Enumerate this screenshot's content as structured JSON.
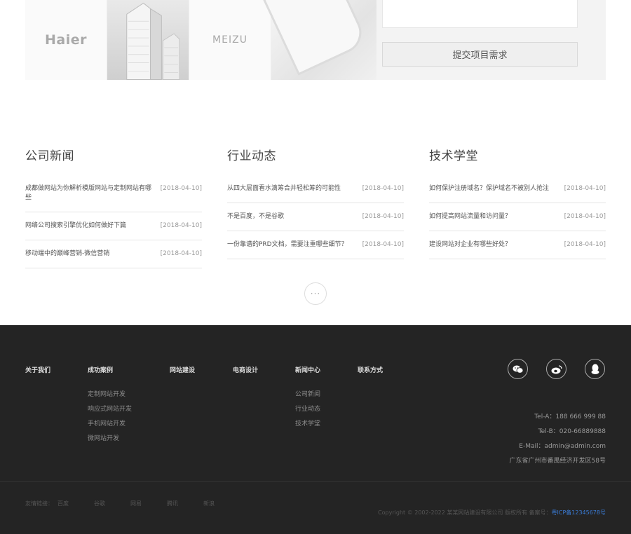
{
  "banner": {
    "logos": [
      "Haier",
      "MEIZU"
    ],
    "submit_label": "提交项目需求"
  },
  "news": [
    {
      "title": "公司新闻",
      "items": [
        {
          "text": "成都做网站为你解析模版网站与定制网站有哪些",
          "date": "[2018-04-10]"
        },
        {
          "text": "网络公司搜索引擎优化如何做好下篇",
          "date": "[2018-04-10]"
        },
        {
          "text": "移动端中的巅峰营销-微信营销",
          "date": "[2018-04-10]"
        }
      ]
    },
    {
      "title": "行业动态",
      "items": [
        {
          "text": "从四大层面看水滴筹合并轻松筹的可能性",
          "date": "[2018-04-10]"
        },
        {
          "text": "不是百度，不是谷歌",
          "date": "[2018-04-10]"
        },
        {
          "text": "一份靠谱的PRD文档，需要注重哪些细节？",
          "date": "[2018-04-10]"
        }
      ]
    },
    {
      "title": "技术学堂",
      "items": [
        {
          "text": "如何保护注册域名？保护域名不被别人抢注",
          "date": "[2018-04-10]"
        },
        {
          "text": "如何提高网站流量和访问量？",
          "date": "[2018-04-10]"
        },
        {
          "text": "建设网站对企业有哪些好处？",
          "date": "[2018-04-10]"
        }
      ]
    }
  ],
  "more_label": "···",
  "footer": {
    "nav": [
      {
        "title": "关于我们",
        "links": []
      },
      {
        "title": "成功案例",
        "links": [
          "定制网站开发",
          "响应式网站开发",
          "手机网站开发",
          "微网站开发"
        ]
      },
      {
        "title": "网站建设",
        "links": []
      },
      {
        "title": "电商设计",
        "links": []
      },
      {
        "title": "新闻中心",
        "links": [
          "公司新闻",
          "行业动态",
          "技术学堂"
        ]
      },
      {
        "title": "联系方式",
        "links": []
      }
    ],
    "social_icons": [
      "wechat-icon",
      "weibo-icon",
      "qq-icon"
    ],
    "contact": {
      "tel_a": "Tel-A：188 666 999 88",
      "tel_b": "Tel-B：020-66889888",
      "email": "E-Mail：admin@admin.com",
      "address": "广东省广州市番禺经济开发区58号"
    },
    "friend_label": "友情链接：",
    "friend_links": [
      "百度",
      "谷歌",
      "网易",
      "腾讯",
      "新浪"
    ],
    "copyright": "Copyright © 2002-2022 某某网站建设有限公司 版权所有   备案号：",
    "icp": "粤ICP备12345678号"
  },
  "colors": {
    "footer_bg": "#242424",
    "icp_link": "#3a7bd5"
  }
}
